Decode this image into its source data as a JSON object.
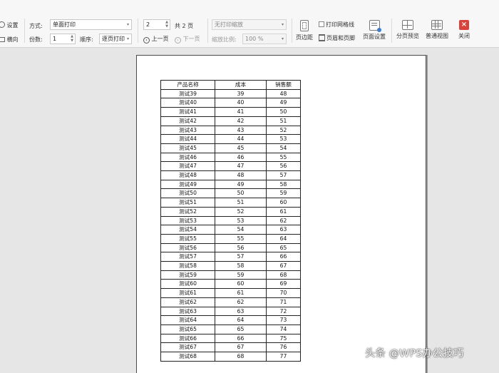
{
  "toolbar": {
    "settings_label": "设置",
    "orientation_label": "横向",
    "mode_label": "方式:",
    "mode_value": "单面打印",
    "copies_label": "份数:",
    "copies_value": "1",
    "order_label": "顺序:",
    "order_value": "逐页打印",
    "page_value": "2",
    "total_pages": "共 2 页",
    "prev_label": "上一页",
    "next_label": "下一页",
    "scaling_value": "无打印缩放",
    "zoom_label": "缩放比例:",
    "zoom_value": "100 %",
    "margins_label": "页边距",
    "gridlines_label": "打印网格线",
    "header_footer_label": "页眉和页脚",
    "page_setup_label": "页面设置",
    "page_break_label": "分页预览",
    "normal_view_label": "普通视图",
    "close_label": "关闭"
  },
  "table": {
    "headers": [
      "产品名称",
      "成本",
      "销售额"
    ],
    "rows": [
      [
        "测试39",
        "39",
        "48"
      ],
      [
        "测试40",
        "40",
        "49"
      ],
      [
        "测试41",
        "41",
        "50"
      ],
      [
        "测试42",
        "42",
        "51"
      ],
      [
        "测试43",
        "43",
        "52"
      ],
      [
        "测试44",
        "44",
        "53"
      ],
      [
        "测试45",
        "45",
        "54"
      ],
      [
        "测试46",
        "46",
        "55"
      ],
      [
        "测试47",
        "47",
        "56"
      ],
      [
        "测试48",
        "48",
        "57"
      ],
      [
        "测试49",
        "49",
        "58"
      ],
      [
        "测试50",
        "50",
        "59"
      ],
      [
        "测试51",
        "51",
        "60"
      ],
      [
        "测试52",
        "52",
        "61"
      ],
      [
        "测试53",
        "53",
        "62"
      ],
      [
        "测试54",
        "54",
        "63"
      ],
      [
        "测试55",
        "55",
        "64"
      ],
      [
        "测试56",
        "56",
        "65"
      ],
      [
        "测试57",
        "57",
        "66"
      ],
      [
        "测试58",
        "58",
        "67"
      ],
      [
        "测试59",
        "59",
        "68"
      ],
      [
        "测试60",
        "60",
        "69"
      ],
      [
        "测试61",
        "61",
        "70"
      ],
      [
        "测试62",
        "62",
        "71"
      ],
      [
        "测试63",
        "63",
        "72"
      ],
      [
        "测试64",
        "64",
        "73"
      ],
      [
        "测试65",
        "65",
        "74"
      ],
      [
        "测试66",
        "66",
        "75"
      ],
      [
        "测试67",
        "67",
        "76"
      ],
      [
        "测试68",
        "68",
        "77"
      ]
    ]
  },
  "watermark": "头条 @WPS办公技巧",
  "colors": {
    "close_button": "#d9423b",
    "toolbar_bg": "#f7f7f7",
    "canvas_bg": "#e6e6e6"
  }
}
